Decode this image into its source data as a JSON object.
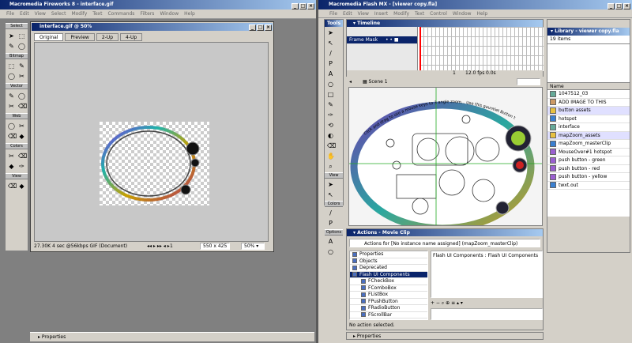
{
  "fw": {
    "title": "Macromedia Fireworks 8 - interface.gif",
    "menu": [
      "File",
      "Edit",
      "View",
      "Select",
      "Modify",
      "Text",
      "Commands",
      "Filters",
      "Window",
      "Help"
    ],
    "toolbox": {
      "sections": [
        "Select",
        "Bitmap",
        "Vector",
        "Web",
        "Colors",
        "View"
      ]
    },
    "doc": {
      "title": "interface.gif @ 50%",
      "tabs": [
        "Original",
        "Preview",
        "2-Up",
        "4-Up"
      ],
      "status_left": "27.30K 4 sec @56kbps GIF (Document)",
      "frame": "1",
      "size": "550 x 425",
      "zoom": "50%"
    }
  },
  "flash": {
    "title": "Macromedia Flash MX - [viewer copy.fla]",
    "menu": [
      "File",
      "Edit",
      "View",
      "Insert",
      "Modify",
      "Text",
      "Control",
      "Window",
      "Help"
    ],
    "tools_header": "Tools",
    "tools_sections": [
      "View",
      "Colors",
      "Options"
    ],
    "timeline": {
      "header": "Timeline",
      "layer": "Frame Mask",
      "frame": "1",
      "fps": "12.0 fps",
      "time": "0.0s"
    },
    "scene": "Scene 1",
    "curved_text": "Click and drag to use a mouse keys to 3 angle zoom... Use this gauntlet Button to zoom in and",
    "actions": {
      "header": "Actions - Movie Clip",
      "target": "Actions for [No instance name assigned] (mapZoom_masterClip)",
      "categories": [
        "Properties",
        "Objects",
        "Deprecated",
        "Flash UI Components",
        "FCheckBox",
        "FComboBox",
        "FListBox",
        "FPushButton",
        "FRadioButton",
        "FScrollBar"
      ],
      "crumb": "Flash UI Components : Flash UI Components",
      "status": "No action selected."
    },
    "properties": "Properties",
    "library": {
      "header": "Library - viewer copy.fla",
      "count": "19 items",
      "name_col": "Name",
      "items": [
        "1047512_03",
        "ADD IMAGE TO THIS",
        "button assets",
        "hotspot",
        "interface",
        "mapZoom_assets",
        "mapZoom_masterClip",
        "MouseOver#1 hotspot",
        "push button - green",
        "push button - red",
        "push button - yellow",
        "twxt.out"
      ],
      "kinds": [
        "bitmap",
        "graphic",
        "folder",
        "movieclip",
        "bitmap",
        "folder",
        "movieclip",
        "button",
        "button",
        "button",
        "button",
        "movieclip"
      ]
    }
  },
  "fw_properties": "Properties",
  "colors": {
    "accent": "#0a246a",
    "panel": "#d4d0c8"
  }
}
